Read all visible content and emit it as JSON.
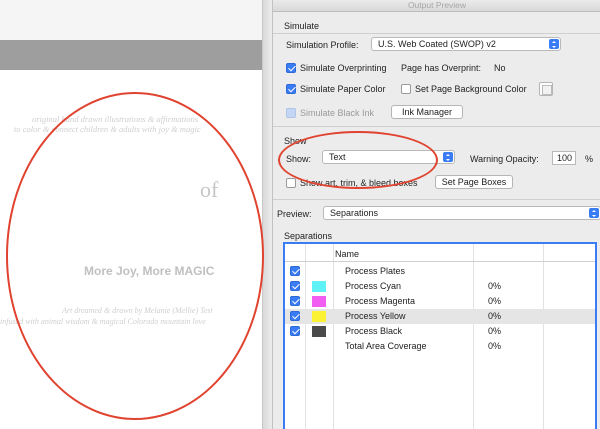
{
  "window": {
    "title": "Output Preview"
  },
  "document": {
    "line1": "original hand drawn illustrations & affirmations",
    "line2": "to color & connect children & adults with joy & magic",
    "of_text": "of",
    "headline": "More Joy, More MAGIC",
    "line4": "Art dreamed & drawn by Melanie (Mellie) Test",
    "line5": "infused with animal wisdom & magical Colorado mountain love"
  },
  "simulate": {
    "group_title": "Simulate",
    "profile_label": "Simulation Profile:",
    "profile_value": "U.S. Web Coated (SWOP) v2",
    "overprinting_label": "Simulate Overprinting",
    "overprinting_checked": true,
    "has_overprint_label": "Page has Overprint:",
    "has_overprint_value": "No",
    "paper_color_label": "Simulate Paper Color",
    "paper_color_checked": true,
    "set_bg_label": "Set Page Background Color",
    "set_bg_checked": false,
    "black_ink_label": "Simulate Black Ink",
    "black_ink_checked": true,
    "ink_manager_label": "Ink Manager"
  },
  "show": {
    "group_title": "Show",
    "show_label": "Show:",
    "show_value": "Text",
    "warning_label": "Warning Opacity:",
    "warning_value": "100",
    "warning_unit": "%",
    "art_boxes_label": "Show art, trim, & bleed boxes",
    "art_boxes_checked": false,
    "set_page_boxes_label": "Set Page Boxes"
  },
  "preview": {
    "label": "Preview:",
    "value": "Separations"
  },
  "separations": {
    "group_title": "Separations",
    "column_name": "Name",
    "rows": [
      {
        "name": "Process Plates",
        "pct": "",
        "checked": true,
        "color": ""
      },
      {
        "name": "Process Cyan",
        "pct": "0%",
        "checked": true,
        "color": "#5ef2f7"
      },
      {
        "name": "Process Magenta",
        "pct": "0%",
        "checked": true,
        "color": "#f25df2"
      },
      {
        "name": "Process Yellow",
        "pct": "0%",
        "checked": true,
        "color": "#faf232"
      },
      {
        "name": "Process Black",
        "pct": "0%",
        "checked": true,
        "color": "#4a4a4a"
      },
      {
        "name": "Total Area Coverage",
        "pct": "0%",
        "checked": false,
        "color": ""
      }
    ]
  },
  "colors": {
    "accent": "#3a7cf3",
    "annotation": "#e0432f"
  }
}
